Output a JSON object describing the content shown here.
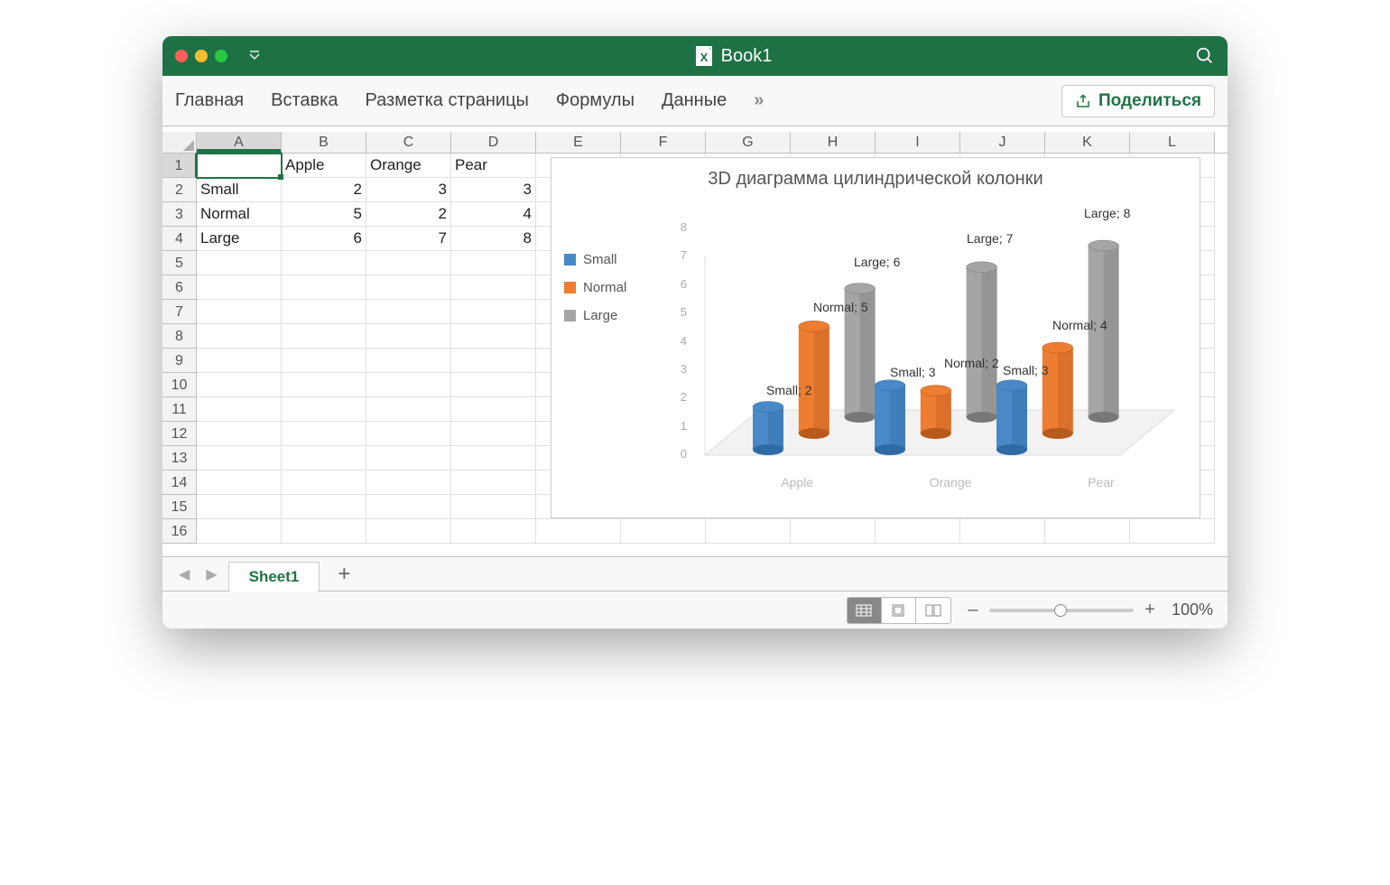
{
  "window": {
    "title": "Book1"
  },
  "ribbon": {
    "tabs": [
      "Главная",
      "Вставка",
      "Разметка страницы",
      "Формулы",
      "Данные"
    ],
    "more": "»",
    "share": "Поделиться"
  },
  "columns": [
    "A",
    "B",
    "C",
    "D",
    "E",
    "F",
    "G",
    "H",
    "I",
    "J",
    "K",
    "L"
  ],
  "rows": [
    "1",
    "2",
    "3",
    "4",
    "5",
    "6",
    "7",
    "8",
    "9",
    "10",
    "11",
    "12",
    "13",
    "14",
    "15",
    "16"
  ],
  "cells": {
    "B1": "Apple",
    "C1": "Orange",
    "D1": "Pear",
    "A2": "Small",
    "B2": "2",
    "C2": "3",
    "D2": "3",
    "A3": "Normal",
    "B3": "5",
    "C3": "2",
    "D3": "4",
    "A4": "Large",
    "B4": "6",
    "C4": "7",
    "D4": "8"
  },
  "selected": "A1",
  "sheet": {
    "tab": "Sheet1",
    "add": "+"
  },
  "status": {
    "zoom": "100%",
    "minus": "–",
    "plus": "+"
  },
  "chart_data": {
    "type": "bar",
    "title": "3D диаграмма цилиндрической колонки",
    "categories": [
      "Apple",
      "Orange",
      "Pear"
    ],
    "series": [
      {
        "name": "Small",
        "values": [
          2,
          3,
          3
        ],
        "color": "#4a89c8"
      },
      {
        "name": "Normal",
        "values": [
          5,
          2,
          4
        ],
        "color": "#ed7d31"
      },
      {
        "name": "Large",
        "values": [
          6,
          7,
          8
        ],
        "color": "#a5a5a5"
      }
    ],
    "ylim": [
      0,
      8
    ],
    "yticks": [
      8,
      7,
      6,
      5,
      4,
      3,
      2,
      1,
      0
    ],
    "labels": [
      {
        "text": "Small; 2",
        "x": 118,
        "y": 210
      },
      {
        "text": "Normal; 5",
        "x": 170,
        "y": 118
      },
      {
        "text": "Large; 6",
        "x": 215,
        "y": 68
      },
      {
        "text": "Small; 3",
        "x": 255,
        "y": 190
      },
      {
        "text": "Normal; 2",
        "x": 315,
        "y": 180
      },
      {
        "text": "Large; 7",
        "x": 340,
        "y": 42
      },
      {
        "text": "Small; 3",
        "x": 380,
        "y": 188
      },
      {
        "text": "Normal; 4",
        "x": 435,
        "y": 138
      },
      {
        "text": "Large; 8",
        "x": 470,
        "y": 14
      }
    ]
  }
}
